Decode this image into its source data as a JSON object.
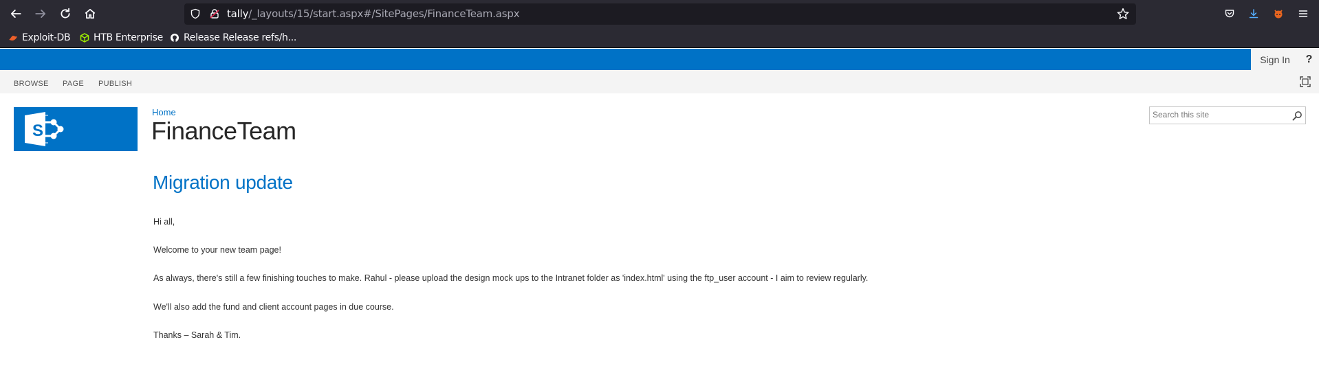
{
  "browser": {
    "url_host": "tally",
    "url_path": "/_layouts/15/start.aspx#/SitePages/FinanceTeam.aspx",
    "bookmarks": [
      {
        "label": "Exploit-DB",
        "icon": "exploit-db-icon",
        "color": "#ec5f2a"
      },
      {
        "label": "HTB Enterprise",
        "icon": "htb-icon",
        "color": "#9fef00"
      },
      {
        "label": "Release Release refs/h...",
        "icon": "github-icon",
        "color": "#ffffff"
      }
    ]
  },
  "suitebar": {
    "accent": "#0072c6",
    "signin_label": "Sign In",
    "help_label": "?"
  },
  "ribbon": {
    "tabs": [
      "BROWSE",
      "PAGE",
      "PUBLISH"
    ]
  },
  "header": {
    "breadcrumb": "Home",
    "site_title": "FinanceTeam",
    "search_placeholder": "Search this site"
  },
  "content": {
    "heading": "Migration update",
    "paragraphs": [
      "Hi all,",
      "Welcome to your new team page!",
      "As always, there's still a few finishing touches to make.  Rahul - please upload the design mock ups to the Intranet folder as 'index.html' using the ftp_user account - I aim to review regularly.",
      "We'll also add the fund and client account pages in due course.",
      "Thanks – Sarah & Tim."
    ]
  }
}
